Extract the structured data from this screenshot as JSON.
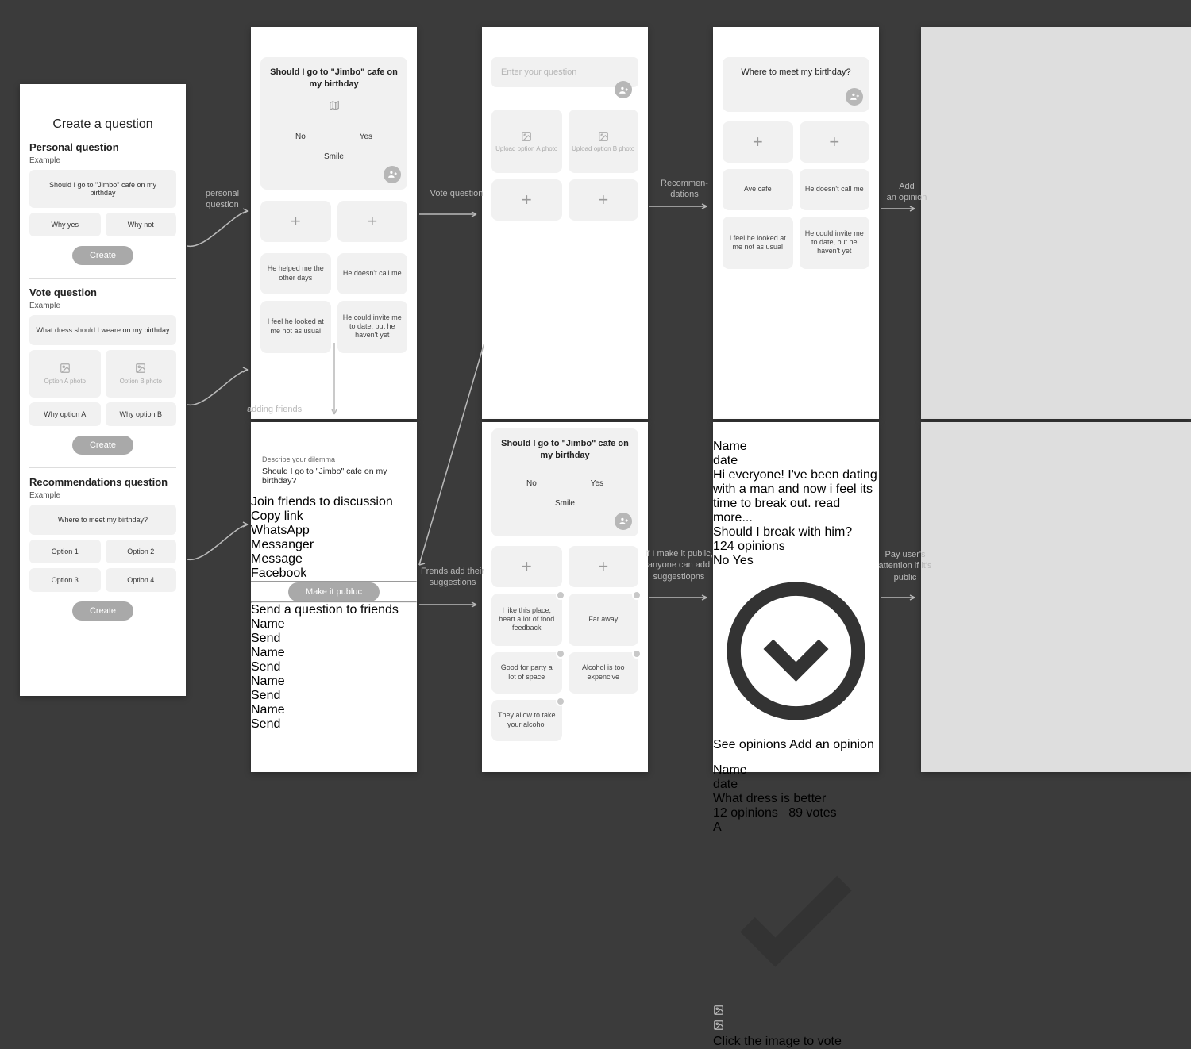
{
  "screens": {
    "s1": {
      "main_title": "Create a question",
      "personal": {
        "heading": "Personal question",
        "example": "Example",
        "question": "Should I go to \"Jimbo\" cafe on my birthday",
        "optA": "Why yes",
        "optB": "Why not",
        "create": "Create"
      },
      "vote": {
        "heading": "Vote question",
        "example": "Example",
        "question": "What dress should I weare on my birthday",
        "photoA": "Option A photo",
        "photoB": "Option B photo",
        "optA": "Why option A",
        "optB": "Why option B",
        "create": "Create"
      },
      "rec": {
        "heading": "Recommendations question",
        "example": "Example",
        "question": "Where to meet my birthday?",
        "opts": [
          "Option 1",
          "Option 2",
          "Option 3",
          "Option 4"
        ],
        "create": "Create"
      }
    },
    "s2": {
      "q": "Should I go to \"Jimbo\" cafe on my birthday",
      "no": "No",
      "yes": "Yes",
      "smile": "Smile",
      "tiles": [
        "He helped me the other days",
        "He doesn't call me",
        "I feel he looked at me not as usual",
        "He could invite me to date, but he haven't yet"
      ]
    },
    "s3": {
      "placeholder": "Enter your question",
      "uploadA": "Upload option A photo",
      "uploadB": "Upload option B photo"
    },
    "s4": {
      "q": "Where to meet my birthday?",
      "tiles": [
        "Ave cafe",
        "He doesn't call me",
        "I feel he looked at me not as usual",
        "He could invite me to date, but he haven't yet"
      ]
    },
    "s5": {
      "desc_label": "Describe your dilemma",
      "desc_text": "Should I go to \"Jimbo\" cafe on my birthday?",
      "join_title": "Join friends to discussion",
      "share": [
        "Copy link",
        "WhatsApp",
        "Messanger",
        "Message",
        "Facebook"
      ],
      "make_public": "Make it publuc",
      "send_title": "Send a question to friends",
      "friend_name": "Name",
      "send": "Send"
    },
    "s6": {
      "q": "Should I go to \"Jimbo\" cafe on my birthday",
      "no": "No",
      "yes": "Yes",
      "smile": "Smile",
      "sugg": [
        "I like this place, heart a lot of food feedback",
        "Far away",
        "Good for party a lot of space",
        "Alcohol is too expencive",
        "They allow to take your alcohol"
      ]
    },
    "s7": {
      "user_name": "Name",
      "user_date": "date",
      "story": "Hi everyone! I've been dating with a man and now i feel its time to break out.",
      "read_more": "read more...",
      "card1_q": "Should I break with him?",
      "card1_sub": "124 opinions",
      "card1_no": "No",
      "card1_yes": "Yes",
      "see": "See opinions",
      "add": "Add an opinion",
      "card2_q": "What dress is better",
      "card2_sub1": "12 opinions",
      "card2_sub2": "89 votes",
      "ab_label": "A",
      "click_text": "Click the image to vote"
    }
  },
  "flow_labels": {
    "personal": "personal question",
    "vote": "Vote question",
    "recom": "Recommen-dations",
    "addop": "Add\nan opinion",
    "adding_friends": "adding friends",
    "friends_add": "Frends add their suggestions",
    "public": "If I make it public, anyone can add suggestiopns",
    "pay": "Pay user's attention if it's public "
  }
}
